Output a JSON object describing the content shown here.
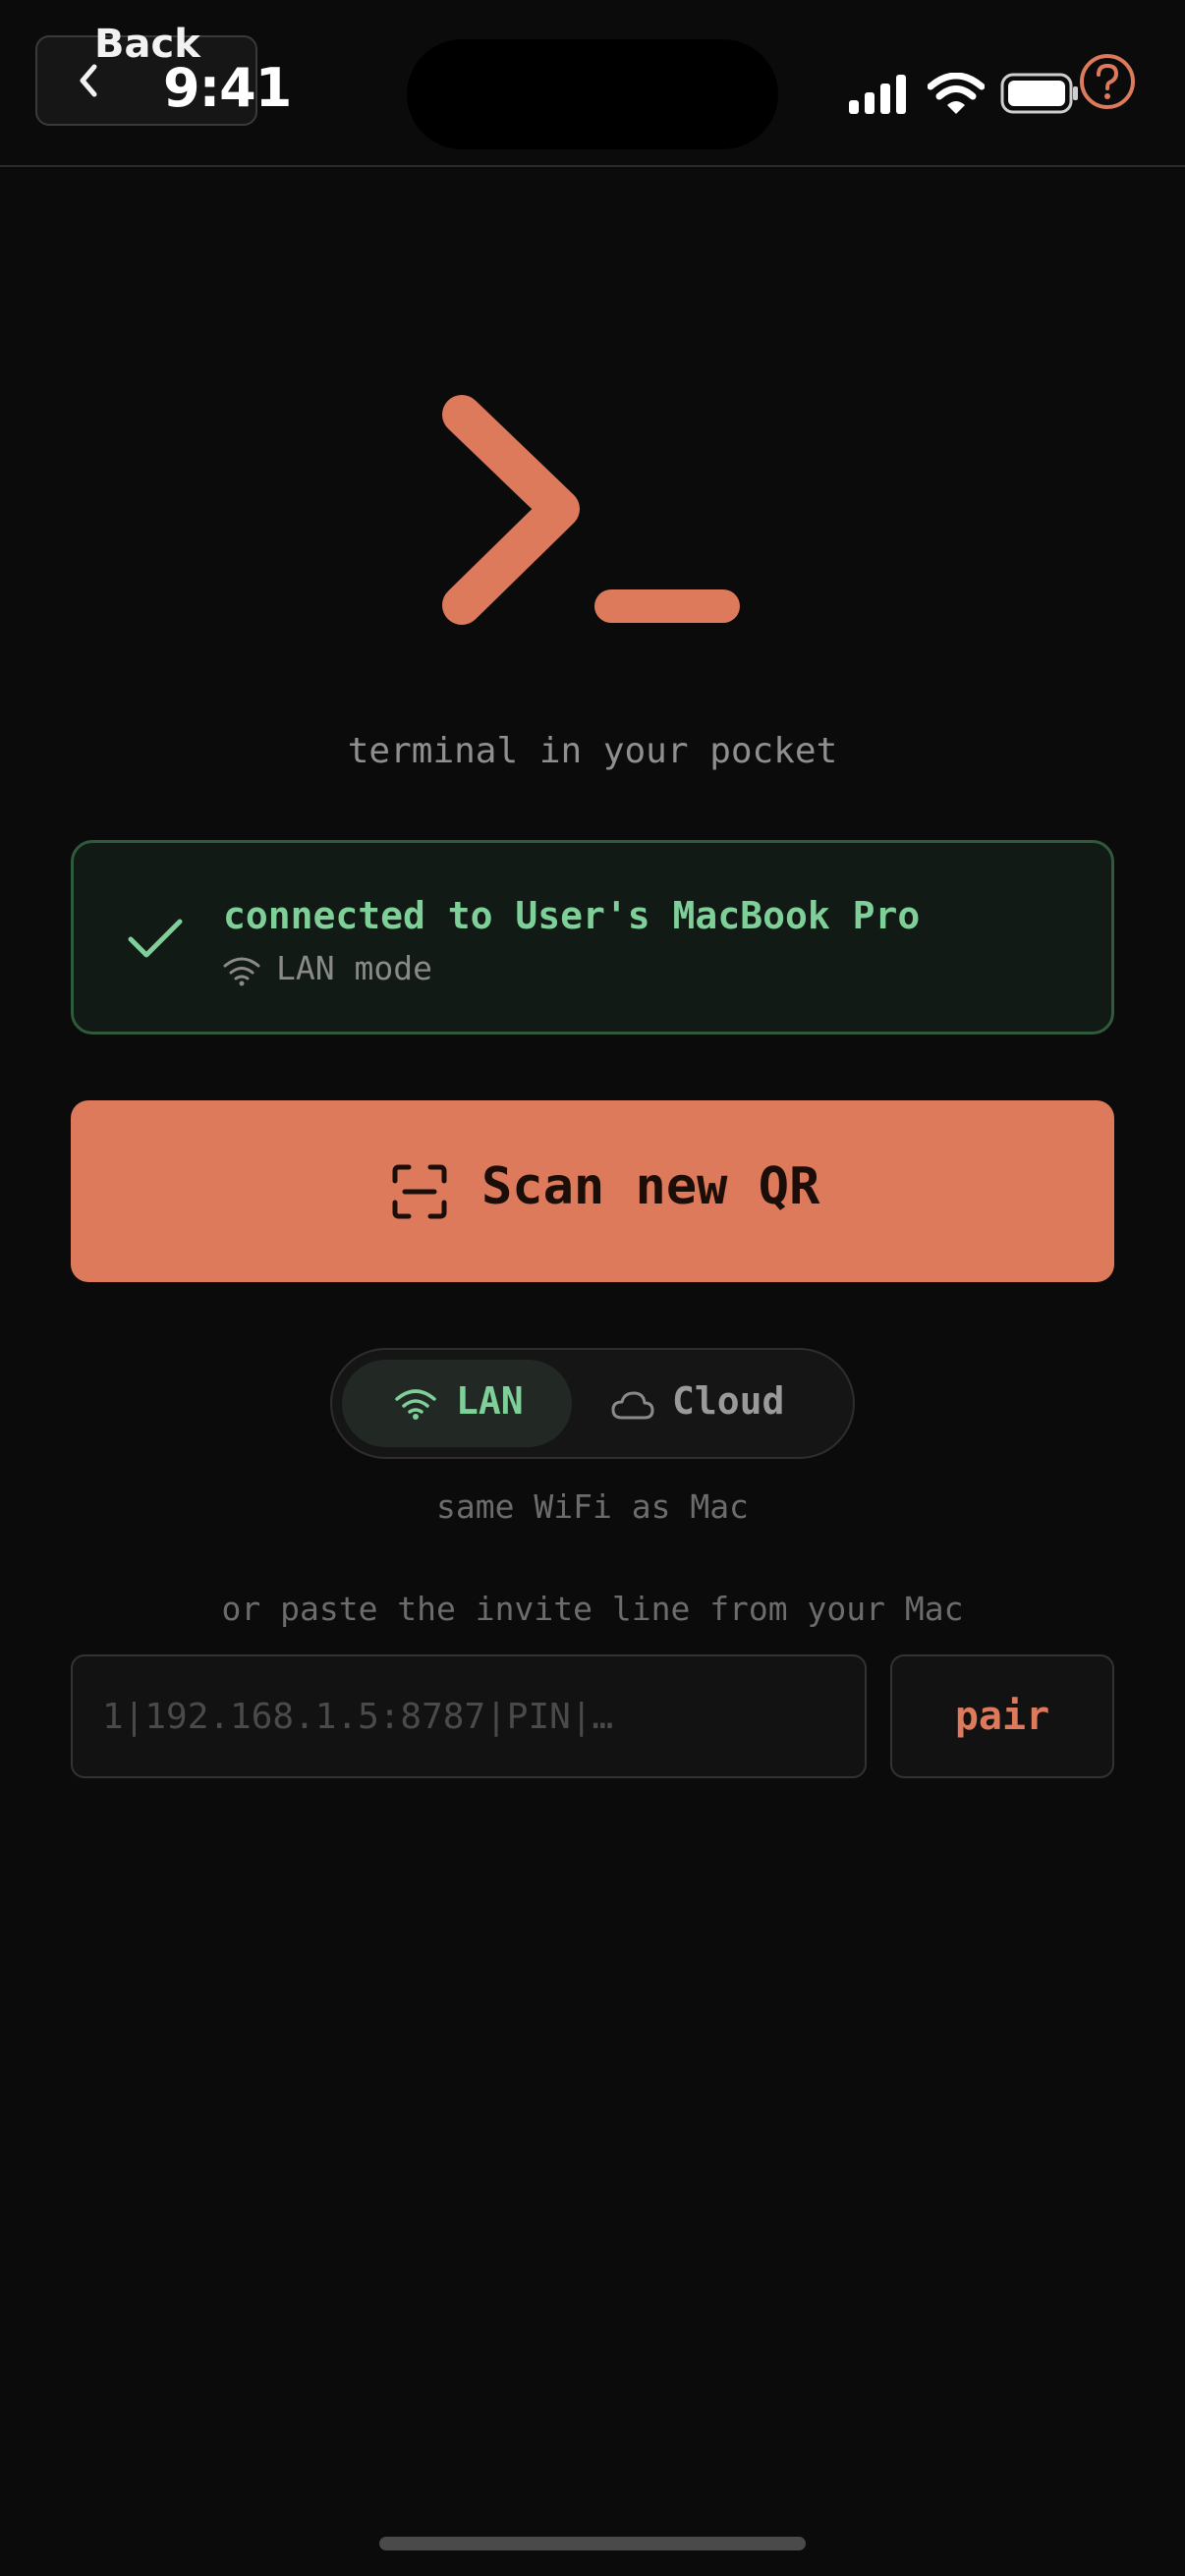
{
  "status_bar": {
    "time": "9:41"
  },
  "header": {
    "back_label": "Back"
  },
  "brand": {
    "tagline": "terminal in your pocket"
  },
  "connection": {
    "title": "connected to User's MacBook Pro",
    "mode_label": "LAN mode"
  },
  "scan": {
    "label": "Scan new QR"
  },
  "mode_toggle": {
    "options": [
      {
        "label": "LAN",
        "selected": true
      },
      {
        "label": "Cloud",
        "selected": false
      }
    ],
    "hint": "same WiFi as Mac"
  },
  "invite": {
    "hint": "or paste the invite line from your Mac",
    "placeholder": "1|192.168.1.5:8787|PIN|…",
    "value": "",
    "button_label": "pair"
  },
  "colors": {
    "accent": "#de7a5c",
    "success": "#7fcf98",
    "background": "#0b0b0b"
  }
}
